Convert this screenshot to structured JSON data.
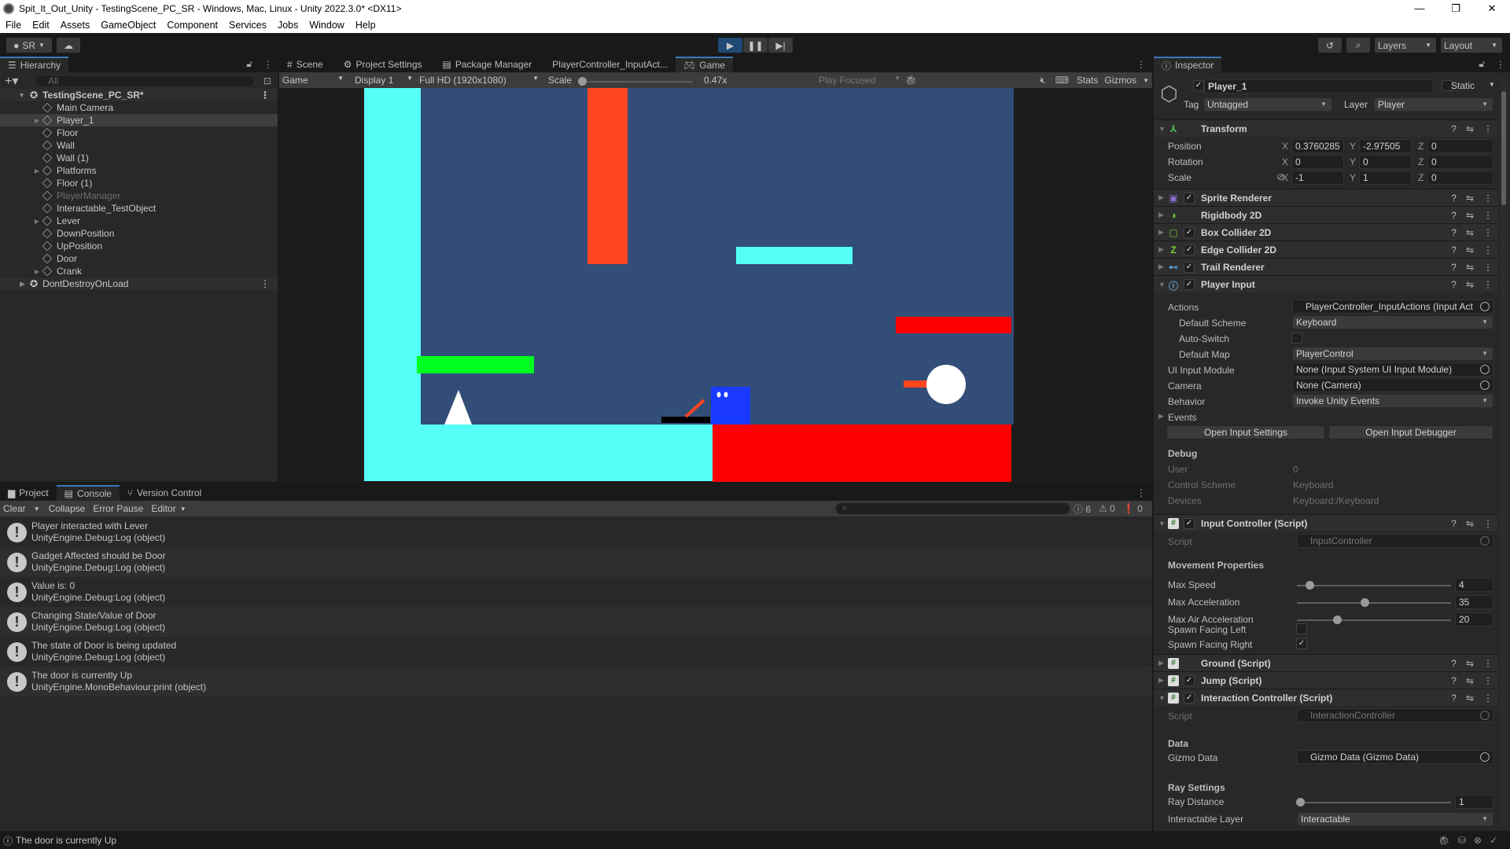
{
  "window": {
    "title": "Spit_It_Out_Unity - TestingScene_PC_SR - Windows, Mac, Linux - Unity 2022.3.0* <DX11>",
    "min": "—",
    "max": "❐",
    "close": "✕"
  },
  "menu": [
    "File",
    "Edit",
    "Assets",
    "GameObject",
    "Component",
    "Services",
    "Jobs",
    "Window",
    "Help"
  ],
  "toolbar": {
    "account": "SR",
    "layers": "Layers",
    "layout": "Layout"
  },
  "hierarchy": {
    "tab": "Hierarchy",
    "search_placeholder": "All",
    "scene": "TestingScene_PC_SR*",
    "items": [
      {
        "label": "Main Camera",
        "expandable": false,
        "disabled": false
      },
      {
        "label": "Player_1",
        "expandable": true,
        "disabled": false,
        "selected": true
      },
      {
        "label": "Floor",
        "expandable": false,
        "disabled": false
      },
      {
        "label": "Wall",
        "expandable": false,
        "disabled": false
      },
      {
        "label": "Wall (1)",
        "expandable": false,
        "disabled": false
      },
      {
        "label": "Platforms",
        "expandable": true,
        "disabled": false
      },
      {
        "label": "Floor (1)",
        "expandable": false,
        "disabled": false
      },
      {
        "label": "PlayerManager",
        "expandable": false,
        "disabled": true
      },
      {
        "label": "Interactable_TestObject",
        "expandable": false,
        "disabled": false
      },
      {
        "label": "Lever",
        "expandable": true,
        "disabled": false
      },
      {
        "label": "DownPosition",
        "expandable": false,
        "disabled": false
      },
      {
        "label": "UpPosition",
        "expandable": false,
        "disabled": false
      },
      {
        "label": "Door",
        "expandable": false,
        "disabled": false
      },
      {
        "label": "Crank",
        "expandable": true,
        "disabled": false
      }
    ],
    "dont_destroy": "DontDestroyOnLoad"
  },
  "center": {
    "tabs": [
      "Scene",
      "Project Settings",
      "Package Manager",
      "PlayerController_InputAct...",
      "Game"
    ],
    "active_tab": "Game",
    "gamebar": {
      "view": "Game",
      "display": "Display 1",
      "resolution": "Full HD (1920x1080)",
      "scale_label": "Scale",
      "scale_value": "0.47x",
      "play_focused": "Play Focused",
      "stats": "Stats",
      "gizmos": "Gizmos"
    },
    "colors": {
      "bg": "#324e78",
      "wall": "#55fff6",
      "orange": "#ff4520",
      "red": "#ff0000",
      "green": "#00ff20",
      "player": "#1a3aff"
    }
  },
  "console": {
    "tabs": [
      "Project",
      "Console",
      "Version Control"
    ],
    "active_tab": "Console",
    "toolbar": {
      "clear": "Clear",
      "collapse": "Collapse",
      "error_pause": "Error Pause",
      "editor": "Editor"
    },
    "counts": {
      "log": "6",
      "warn": "0",
      "error": "0"
    },
    "entries": [
      {
        "message": "Player interacted with Lever",
        "source": "UnityEngine.Debug:Log (object)"
      },
      {
        "message": "Gadget Affected should be Door",
        "source": "UnityEngine.Debug:Log (object)"
      },
      {
        "message": "Value is: 0",
        "source": "UnityEngine.Debug:Log (object)"
      },
      {
        "message": "Changing State/Value of Door",
        "source": "UnityEngine.Debug:Log (object)"
      },
      {
        "message": "The state of Door is being updated",
        "source": "UnityEngine.Debug:Log (object)"
      },
      {
        "message": "The door is currently Up",
        "source": "UnityEngine.MonoBehaviour:print (object)"
      }
    ]
  },
  "inspector": {
    "tab": "Inspector",
    "object_name": "Player_1",
    "static": "Static",
    "tag_label": "Tag",
    "tag": "Untagged",
    "layer_label": "Layer",
    "layer": "Player",
    "transform": {
      "title": "Transform",
      "position": {
        "label": "Position",
        "x": "0.3760285",
        "y": "-2.97505",
        "z": "0"
      },
      "rotation": {
        "label": "Rotation",
        "x": "0",
        "y": "0",
        "z": "0"
      },
      "scale": {
        "label": "Scale",
        "x": "-1",
        "y": "1",
        "z": "0"
      }
    },
    "components": [
      "Sprite Renderer",
      "Rigidbody 2D",
      "Box Collider 2D",
      "Edge Collider 2D",
      "Trail Renderer",
      "Player Input"
    ],
    "player_input": {
      "actions_label": "Actions",
      "actions": "PlayerController_InputActions (Input Act",
      "default_scheme_label": "Default Scheme",
      "default_scheme": "Keyboard",
      "auto_switch_label": "Auto-Switch",
      "default_map_label": "Default Map",
      "default_map": "PlayerControl",
      "ui_module_label": "UI Input Module",
      "ui_module": "None (Input System UI Input Module)",
      "camera_label": "Camera",
      "camera": "None (Camera)",
      "behavior_label": "Behavior",
      "behavior": "Invoke Unity Events",
      "events": "Events",
      "open_settings": "Open Input Settings",
      "open_debugger": "Open Input Debugger",
      "debug": {
        "title": "Debug",
        "user_label": "User",
        "user": "0",
        "scheme_label": "Control Scheme",
        "scheme": "Keyboard",
        "devices_label": "Devices",
        "devices": "Keyboard:/Keyboard"
      }
    },
    "input_controller": {
      "title": "Input Controller (Script)",
      "script_label": "Script",
      "script": "InputController",
      "section": "Movement Properties",
      "max_speed_label": "Max Speed",
      "max_speed": "4",
      "max_speed_frac": 0.08,
      "max_accel_label": "Max Acceleration",
      "max_accel": "35",
      "max_accel_frac": 0.44,
      "max_air_label": "Max Air Acceleration",
      "max_air": "20",
      "max_air_frac": 0.26,
      "spawn_left_label": "Spawn Facing Left",
      "spawn_right_label": "Spawn Facing Right"
    },
    "ground": "Ground (Script)",
    "jump": "Jump (Script)",
    "interaction": {
      "title": "Interaction Controller (Script)",
      "script_label": "Script",
      "script": "InteractionController",
      "data_section": "Data",
      "gizmo_label": "Gizmo Data",
      "gizmo": "Gizmo Data (Gizmo Data)",
      "ray_section": "Ray Settings",
      "ray_label": "Ray Distance",
      "ray": "1",
      "ray_frac": 0.02,
      "layer_label": "Interactable Layer",
      "layer": "Interactable"
    }
  },
  "status": {
    "message": "The door is currently Up"
  }
}
